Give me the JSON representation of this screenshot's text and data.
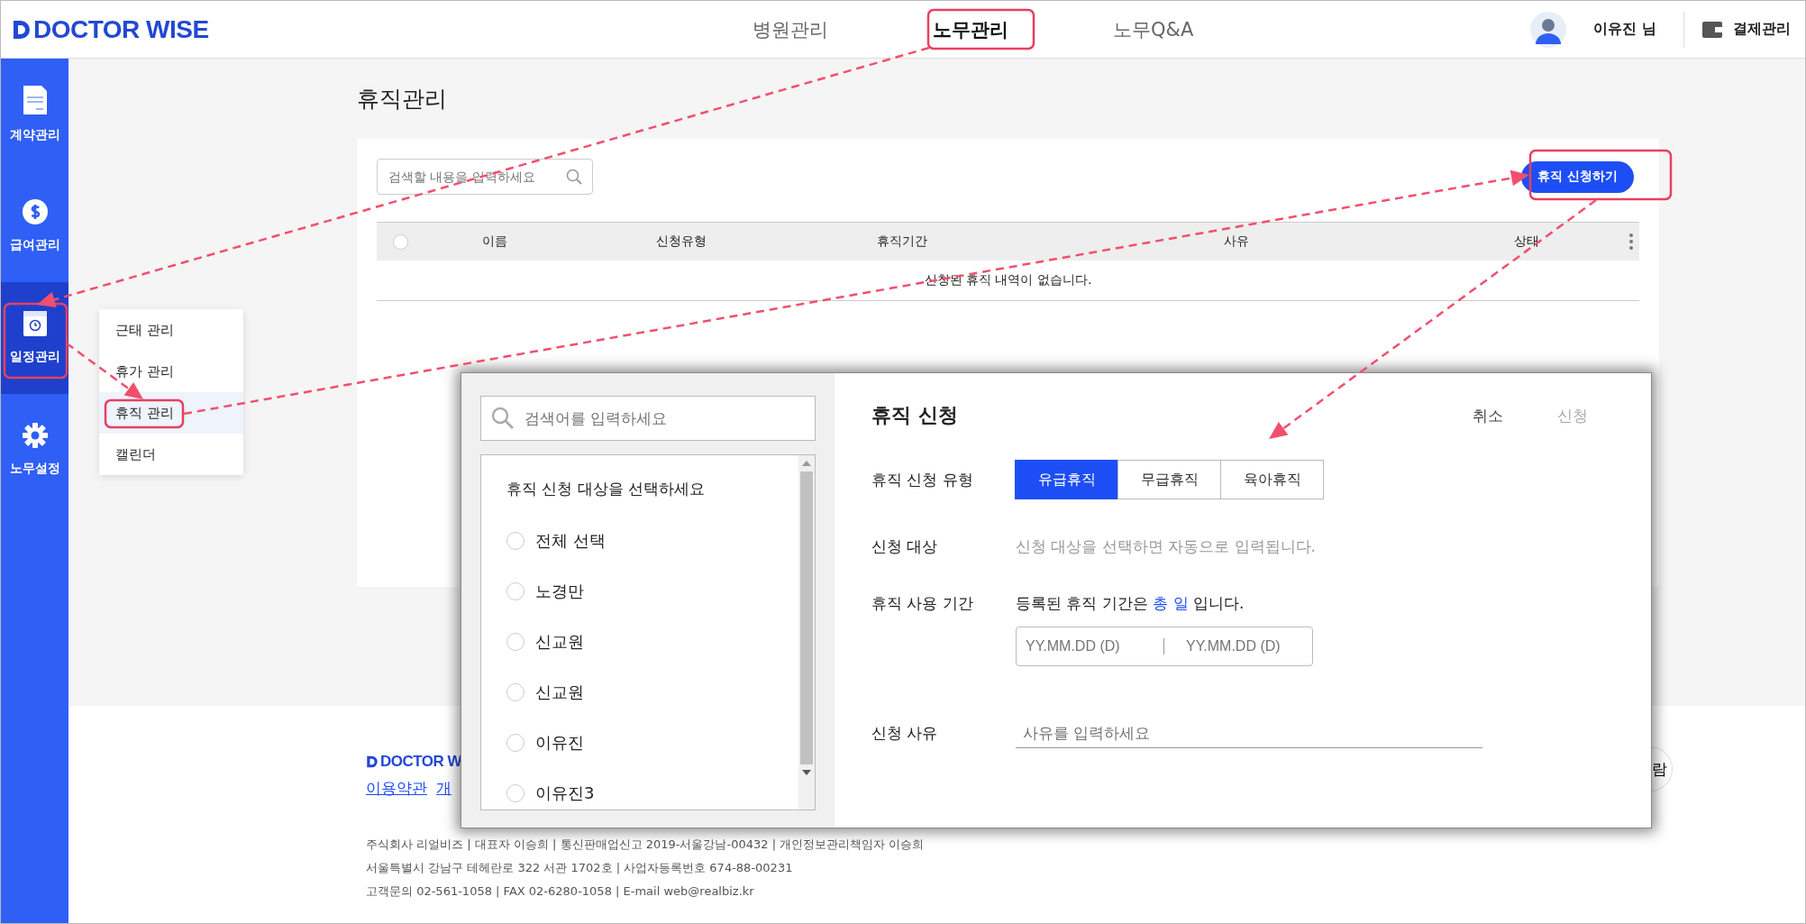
{
  "header": {
    "logo": "DOCTOR WISE",
    "nav": [
      {
        "label": "병원관리",
        "selected": false
      },
      {
        "label": "노무관리",
        "selected": true
      },
      {
        "label": "노무Q&A",
        "selected": false
      }
    ],
    "user": "이유진 님",
    "billing": "결제관리"
  },
  "sidebar": {
    "items": [
      {
        "label": "계약관리",
        "kind": "document",
        "selected": false
      },
      {
        "label": "급여관리",
        "kind": "dollar",
        "selected": false
      },
      {
        "label": "일정관리",
        "kind": "calendar",
        "selected": true
      },
      {
        "label": "노무설정",
        "kind": "gear",
        "selected": false
      }
    ]
  },
  "submenu": {
    "items": [
      {
        "label": "근태 관리",
        "selected": false
      },
      {
        "label": "휴가 관리",
        "selected": false
      },
      {
        "label": "휴직 관리",
        "selected": true
      },
      {
        "label": "캘린더",
        "selected": false
      }
    ]
  },
  "page": {
    "title": "휴직관리",
    "search": {
      "placeholder": "검색할 내용을 입력하세요"
    },
    "apply_button": "휴직 신청하기",
    "table": {
      "select_all": {
        "selected": false
      },
      "columns": [
        "이름",
        "신청유형",
        "휴직기간",
        "사유",
        "상태"
      ],
      "empty_message": "신청된 휴직 내역이 없습니다."
    }
  },
  "footer": {
    "logo": "DOCTOR W",
    "links": [
      "이용약관",
      "개"
    ],
    "side_button": "람",
    "lines": [
      "주식회사 리얼비즈 | 대표자 이승희 | 통신판매업신고 2019-서울강남-00432 | 개인정보관리책임자 이승희",
      "서울특별시 강남구 테헤란로 322 서관 1702호 | 사업자등록번호 674-88-00231",
      "고객문의 02-561-1058 | FAX 02-6280-1058 | E-mail web@realbiz.kr"
    ]
  },
  "modal": {
    "search": {
      "placeholder": "검색어를 입력하세요"
    },
    "list_title": "휴직 신청 대상을 선택하세요",
    "people": [
      {
        "name": "전체 선택",
        "selected": false
      },
      {
        "name": "노경만",
        "selected": false
      },
      {
        "name": "신교원",
        "selected": false
      },
      {
        "name": "신교원",
        "selected": false
      },
      {
        "name": "이유진",
        "selected": false
      },
      {
        "name": "이유진3",
        "selected": false
      }
    ],
    "title": "휴직 신청",
    "actions": [
      {
        "label": "취소",
        "disabled": false
      },
      {
        "label": "신청",
        "disabled": true
      }
    ],
    "fields": [
      {
        "kind": "segmented",
        "label": "휴직 신청 유형",
        "options": [
          {
            "label": "유급휴직",
            "selected": true
          },
          {
            "label": "무급휴직",
            "selected": false
          },
          {
            "label": "육아휴직",
            "selected": false
          }
        ]
      },
      {
        "kind": "note",
        "label": "신청 대상",
        "text": "신청 대상을 선택하면 자동으로 입력됩니다."
      },
      {
        "kind": "period",
        "label": "휴직 사용 기간",
        "summary_before": "등록된 휴직 기간은",
        "summary_highlight": "총 일",
        "summary_after": "입니다.",
        "start_placeholder": "YY.MM.DD (D)",
        "end_placeholder": "YY.MM.DD (D)"
      },
      {
        "kind": "text",
        "label": "신청 사유",
        "placeholder": "사유를 입력하세요"
      }
    ]
  }
}
